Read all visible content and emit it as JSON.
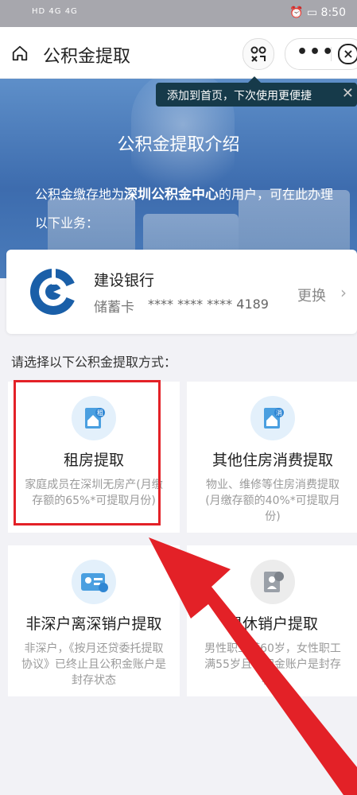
{
  "status": {
    "left": "HD 4G 4G",
    "time": "8:50"
  },
  "nav": {
    "title": "公积金提取",
    "more": "•••",
    "close": "×"
  },
  "banner": {
    "title": "公积金提取介绍",
    "desc_prefix": "公积金缴存地为",
    "desc_bold": "深圳公积金中心",
    "desc_suffix": "的用户，可在此办理以下业务："
  },
  "tooltip": {
    "text": "添加到首页，下次使用更便捷",
    "close": "✕"
  },
  "card": {
    "bank": "建设银行",
    "type": "储蓄卡",
    "number": "**** **** **** 4189",
    "change": "更换",
    "chevron": "›"
  },
  "prompt": "请选择以下公积金提取方式：",
  "options": [
    {
      "name": "租房提取",
      "sub": "家庭成员在深圳无房产(月缴存额的65%*可提取月份)",
      "icon": "house-doc-icon"
    },
    {
      "name": "其他住房消费提取",
      "sub": "物业、维修等住房消费提取(月缴存额的40%*可提取月份)",
      "icon": "house-doc-icon"
    },
    {
      "name": "非深户离深销户提取",
      "sub": "非深户，《按月还贷委托提取协议》已终止且公积金账户是封存状态",
      "icon": "id-card-icon"
    },
    {
      "name": "退休销户提取",
      "sub": "男性职工满60岁，女性职工满55岁且公积金账户是封存状态",
      "icon": "retire-doc-icon"
    }
  ],
  "colors": {
    "accent": "#e32127",
    "banner": "#4a7cbb",
    "icon_bg": "#e3f0fb"
  }
}
